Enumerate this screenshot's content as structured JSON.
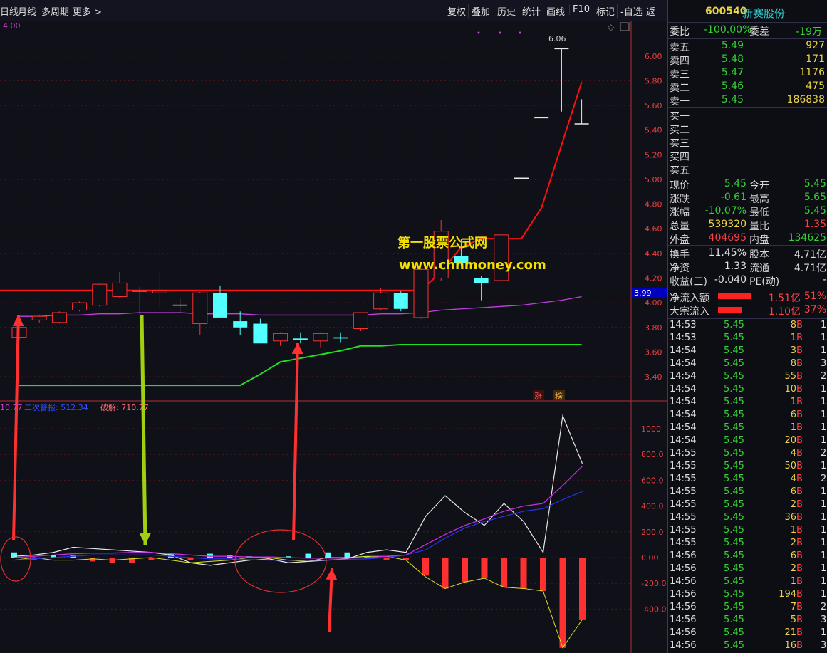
{
  "toolbar": {
    "left_tabs": [
      "日线",
      "月线",
      "多周期",
      "更多 >"
    ],
    "right_buttons": [
      "复权",
      "叠加",
      "历史",
      "统计",
      "画线",
      "F10",
      "标记",
      "-自选",
      "返回"
    ]
  },
  "chart": {
    "top_left_value": "4.00",
    "high_marker": "6.06",
    "cursor_price": "3.99",
    "price_ticks": [
      "6.00",
      "5.80",
      "5.60",
      "5.40",
      "5.20",
      "5.00",
      "4.80",
      "4.60",
      "4.40",
      "4.20",
      "4.00",
      "3.80",
      "3.60",
      "3.40"
    ],
    "badges": [
      "涨",
      "榜"
    ],
    "indicator_legend": {
      "first_value": "10.77",
      "second_label": "二次警报: 512.34",
      "third_label": "破解: 710.77"
    },
    "indicator_ticks": [
      "1000",
      "800.0",
      "600.0",
      "400.0",
      "200.0",
      "0.00",
      "-200.0",
      "-400.0"
    ],
    "watermark_line1": "第一股票公式网",
    "watermark_line2": "www.chnmoney.com"
  },
  "colors": {
    "up": "#ff3030",
    "down": "#54ffff",
    "ma_support": "#20e020",
    "ma_purple": "#c040e0",
    "resistance": "#ff1010",
    "arrow_red": "#ff3030",
    "arrow_green": "#a0d010"
  },
  "stock": {
    "code": "600540",
    "name": "新赛股份"
  },
  "order_book": {
    "weibi_label": "委比",
    "weibi_value": "-100.00%",
    "weicha_label": "委差",
    "weicha_value": "-19万",
    "sells": [
      {
        "label": "卖五",
        "price": "5.49",
        "volume": "927"
      },
      {
        "label": "卖四",
        "price": "5.48",
        "volume": "171"
      },
      {
        "label": "卖三",
        "price": "5.47",
        "volume": "1176"
      },
      {
        "label": "卖二",
        "price": "5.46",
        "volume": "475"
      },
      {
        "label": "卖一",
        "price": "5.45",
        "volume": "186838"
      }
    ],
    "buys": [
      "买一",
      "买二",
      "买三",
      "买四",
      "买五"
    ]
  },
  "quote": {
    "rows": [
      {
        "l1": "现价",
        "v1": "5.45",
        "l2": "今开",
        "v2": "5.45",
        "c1": "g",
        "c2": "g"
      },
      {
        "l1": "涨跌",
        "v1": "-0.61",
        "l2": "最高",
        "v2": "5.65",
        "c1": "g",
        "c2": "g"
      },
      {
        "l1": "涨幅",
        "v1": "-10.07%",
        "l2": "最低",
        "v2": "5.45",
        "c1": "g",
        "c2": "g"
      },
      {
        "l1": "总量",
        "v1": "539320",
        "l2": "量比",
        "v2": "1.35",
        "c1": "y",
        "c2": "r"
      },
      {
        "l1": "外盘",
        "v1": "404695",
        "l2": "内盘",
        "v2": "134625",
        "c1": "r",
        "c2": "g"
      },
      {
        "l1": "换手",
        "v1": "11.45%",
        "l2": "股本",
        "v2": "4.71亿",
        "c1": "w",
        "c2": "w"
      },
      {
        "l1": "净资",
        "v1": "1.33",
        "l2": "流通",
        "v2": "4.71亿",
        "c1": "w",
        "c2": "w"
      },
      {
        "l1": "收益(三)",
        "v1": "-0.040",
        "l2": "PE(动)",
        "v2": "-",
        "c1": "w",
        "c2": "w"
      }
    ],
    "netflow_label": "净流入额",
    "netflow_value": "1.51亿",
    "netflow_pct": "51%",
    "block_label": "大宗流入",
    "block_value": "1.10亿",
    "block_pct": "37%"
  },
  "ticks": [
    {
      "time": "14:53",
      "price": "5.45",
      "vol": "8",
      "side": "B",
      "n": "1"
    },
    {
      "time": "14:53",
      "price": "5.45",
      "vol": "1",
      "side": "B",
      "n": "1"
    },
    {
      "time": "14:54",
      "price": "5.45",
      "vol": "3",
      "side": "B",
      "n": "1"
    },
    {
      "time": "14:54",
      "price": "5.45",
      "vol": "8",
      "side": "B",
      "n": "3"
    },
    {
      "time": "14:54",
      "price": "5.45",
      "vol": "55",
      "side": "B",
      "n": "2"
    },
    {
      "time": "14:54",
      "price": "5.45",
      "vol": "10",
      "side": "B",
      "n": "1"
    },
    {
      "time": "14:54",
      "price": "5.45",
      "vol": "1",
      "side": "B",
      "n": "1"
    },
    {
      "time": "14:54",
      "price": "5.45",
      "vol": "6",
      "side": "B",
      "n": "1"
    },
    {
      "time": "14:54",
      "price": "5.45",
      "vol": "1",
      "side": "B",
      "n": "1"
    },
    {
      "time": "14:54",
      "price": "5.45",
      "vol": "20",
      "side": "B",
      "n": "1"
    },
    {
      "time": "14:55",
      "price": "5.45",
      "vol": "4",
      "side": "B",
      "n": "2"
    },
    {
      "time": "14:55",
      "price": "5.45",
      "vol": "50",
      "side": "B",
      "n": "1"
    },
    {
      "time": "14:55",
      "price": "5.45",
      "vol": "4",
      "side": "B",
      "n": "2"
    },
    {
      "time": "14:55",
      "price": "5.45",
      "vol": "6",
      "side": "B",
      "n": "1"
    },
    {
      "time": "14:55",
      "price": "5.45",
      "vol": "2",
      "side": "B",
      "n": "1"
    },
    {
      "time": "14:55",
      "price": "5.45",
      "vol": "36",
      "side": "B",
      "n": "1"
    },
    {
      "time": "14:55",
      "price": "5.45",
      "vol": "1",
      "side": "B",
      "n": "1"
    },
    {
      "time": "14:55",
      "price": "5.45",
      "vol": "2",
      "side": "B",
      "n": "1"
    },
    {
      "time": "14:56",
      "price": "5.45",
      "vol": "6",
      "side": "B",
      "n": "1"
    },
    {
      "time": "14:56",
      "price": "5.45",
      "vol": "2",
      "side": "B",
      "n": "1"
    },
    {
      "time": "14:56",
      "price": "5.45",
      "vol": "1",
      "side": "B",
      "n": "1"
    },
    {
      "time": "14:56",
      "price": "5.45",
      "vol": "194",
      "side": "B",
      "n": "1"
    },
    {
      "time": "14:56",
      "price": "5.45",
      "vol": "7",
      "side": "B",
      "n": "2"
    },
    {
      "time": "14:56",
      "price": "5.45",
      "vol": "5",
      "side": "B",
      "n": "3"
    },
    {
      "time": "14:56",
      "price": "5.45",
      "vol": "21",
      "side": "B",
      "n": "1"
    },
    {
      "time": "14:56",
      "price": "5.45",
      "vol": "16",
      "side": "B",
      "n": "3"
    }
  ],
  "candles": [
    {
      "o": 3.72,
      "h": 3.82,
      "l": 3.7,
      "c": 3.8
    },
    {
      "o": 3.86,
      "h": 3.9,
      "l": 3.84,
      "c": 3.89
    },
    {
      "o": 3.84,
      "h": 3.93,
      "l": 3.83,
      "c": 3.92
    },
    {
      "o": 3.94,
      "h": 4.01,
      "l": 3.93,
      "c": 4.0
    },
    {
      "o": 3.98,
      "h": 4.16,
      "l": 3.97,
      "c": 4.15
    },
    {
      "o": 4.05,
      "h": 4.25,
      "l": 4.04,
      "c": 4.16
    },
    {
      "o": 4.09,
      "h": 4.13,
      "l": 3.9,
      "c": 4.1
    },
    {
      "o": 4.08,
      "h": 4.24,
      "l": 3.96,
      "c": 4.1
    },
    {
      "o": 3.98,
      "h": 4.04,
      "l": 3.92,
      "c": 3.98
    },
    {
      "o": 3.83,
      "h": 4.09,
      "l": 3.74,
      "c": 4.08
    },
    {
      "o": 4.08,
      "h": 4.14,
      "l": 3.92,
      "c": 3.88
    },
    {
      "o": 3.85,
      "h": 3.93,
      "l": 3.74,
      "c": 3.8
    },
    {
      "o": 3.83,
      "h": 3.87,
      "l": 3.68,
      "c": 3.67
    },
    {
      "o": 3.69,
      "h": 3.76,
      "l": 3.65,
      "c": 3.75
    },
    {
      "o": 3.71,
      "h": 3.76,
      "l": 3.67,
      "c": 3.7
    },
    {
      "o": 3.69,
      "h": 3.76,
      "l": 3.64,
      "c": 3.75
    },
    {
      "o": 3.72,
      "h": 3.76,
      "l": 3.68,
      "c": 3.71
    },
    {
      "o": 3.79,
      "h": 3.92,
      "l": 3.77,
      "c": 3.92
    },
    {
      "o": 3.95,
      "h": 4.12,
      "l": 3.94,
      "c": 4.08
    },
    {
      "o": 4.08,
      "h": 4.1,
      "l": 3.93,
      "c": 3.95
    },
    {
      "o": 3.88,
      "h": 4.28,
      "l": 3.87,
      "c": 4.27
    },
    {
      "o": 4.2,
      "h": 4.67,
      "l": 4.18,
      "c": 4.58
    },
    {
      "o": 4.38,
      "h": 4.52,
      "l": 4.3,
      "c": 4.32
    },
    {
      "o": 4.2,
      "h": 4.22,
      "l": 4.02,
      "c": 4.16
    },
    {
      "o": 4.18,
      "h": 4.56,
      "l": 4.17,
      "c": 4.55
    },
    {
      "o": 5.01,
      "h": 5.01,
      "l": 5.01,
      "c": 5.01
    },
    {
      "o": 5.5,
      "h": 5.5,
      "l": 5.5,
      "c": 5.5
    },
    {
      "o": 6.06,
      "h": 6.06,
      "l": 5.55,
      "c": 6.06
    },
    {
      "o": 5.45,
      "h": 5.65,
      "l": 5.45,
      "c": 5.45
    }
  ],
  "resistance_line": [
    4.1,
    4.1,
    4.1,
    4.1,
    4.1,
    4.1,
    4.1,
    4.1,
    4.1,
    4.1,
    4.1,
    4.1,
    4.1,
    4.1,
    4.1,
    4.1,
    4.1,
    4.1,
    4.1,
    4.1,
    4.1,
    4.25,
    4.45,
    4.52,
    4.52,
    4.52,
    4.77,
    5.28,
    5.79
  ],
  "ma_purple": [
    3.89,
    3.89,
    3.9,
    3.9,
    3.91,
    3.91,
    3.92,
    3.92,
    3.92,
    3.91,
    3.91,
    3.91,
    3.9,
    3.9,
    3.9,
    3.9,
    3.9,
    3.9,
    3.91,
    3.91,
    3.92,
    3.94,
    3.95,
    3.96,
    3.97,
    3.98,
    4.0,
    4.02,
    4.05
  ],
  "ma_green": [
    3.33,
    3.33,
    3.33,
    3.33,
    3.33,
    3.33,
    3.33,
    3.33,
    3.33,
    3.33,
    3.33,
    3.33,
    3.42,
    3.52,
    3.55,
    3.58,
    3.61,
    3.65,
    3.65,
    3.66,
    3.66,
    3.66,
    3.66,
    3.66,
    3.66,
    3.66,
    3.66,
    3.66,
    3.66
  ],
  "indicator": {
    "white": [
      10,
      20,
      40,
      80,
      70,
      60,
      50,
      40,
      20,
      -40,
      -60,
      -40,
      -20,
      -10,
      -40,
      -30,
      -20,
      -10,
      40,
      60,
      40,
      320,
      480,
      350,
      250,
      420,
      280,
      40,
      1100,
      730
    ],
    "purple": [
      0,
      10,
      20,
      30,
      35,
      35,
      40,
      40,
      30,
      20,
      10,
      10,
      5,
      5,
      0,
      -5,
      -5,
      -5,
      0,
      10,
      20,
      100,
      180,
      250,
      300,
      360,
      400,
      420,
      560,
      710
    ],
    "blue": [
      -20,
      -10,
      0,
      10,
      20,
      20,
      20,
      20,
      10,
      0,
      -10,
      -10,
      -15,
      -20,
      -20,
      -20,
      -20,
      -15,
      -10,
      0,
      20,
      60,
      150,
      230,
      280,
      320,
      360,
      380,
      450,
      512
    ],
    "yellow": [
      -20,
      0,
      -20,
      -20,
      -10,
      -20,
      -10,
      0,
      -20,
      -40,
      -30,
      -20,
      0,
      0,
      -20,
      -30,
      0,
      0,
      10,
      10,
      -20,
      -150,
      -240,
      -190,
      -160,
      -230,
      -240,
      -260,
      -700,
      -480
    ],
    "bars": [
      40,
      -20,
      20,
      20,
      -30,
      -40,
      -40,
      -20,
      30,
      -20,
      30,
      20,
      10,
      -10,
      10,
      30,
      40,
      40,
      10,
      -20,
      -20,
      -140,
      -240,
      -190,
      -160,
      -230,
      -240,
      -260,
      -700,
      -480
    ]
  }
}
